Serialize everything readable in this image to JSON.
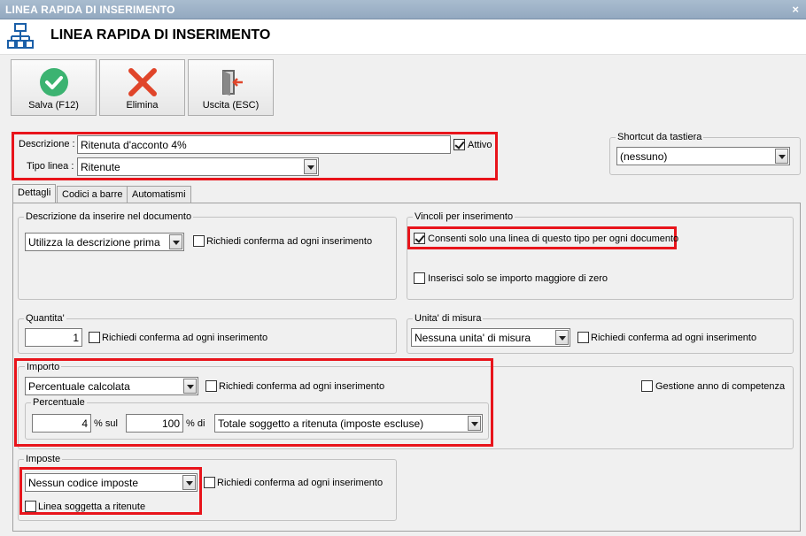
{
  "window": {
    "title": "LINEA RAPIDA DI INSERIMENTO",
    "close_glyph": "×"
  },
  "header": {
    "title": "LINEA RAPIDA DI INSERIMENTO",
    "icon": "network-tree-icon"
  },
  "toolbar": {
    "save_label": "Salva (F12)",
    "delete_label": "Elimina",
    "exit_label": "Uscita (ESC)"
  },
  "main": {
    "descrizione_label": "Descrizione :",
    "descrizione_value": "Ritenuta d'acconto 4%",
    "attivo_label": "Attivo",
    "attivo_checked": true,
    "tipo_linea_label": "Tipo linea :",
    "tipo_linea_value": "Ritenute"
  },
  "shortcut": {
    "title": "Shortcut da tastiera",
    "value": "(nessuno)"
  },
  "tabs": [
    {
      "label": "Dettagli",
      "active": true
    },
    {
      "label": "Codici a barre",
      "active": false
    },
    {
      "label": "Automatismi",
      "active": false
    }
  ],
  "descrizione_doc": {
    "title": "Descrizione da inserire nel documento",
    "combo_value": "Utilizza la descrizione prima",
    "confirm_label": "Richiedi conferma ad ogni inserimento",
    "confirm_checked": false
  },
  "vincoli": {
    "title": "Vincoli per inserimento",
    "one_line_label": "Consenti solo una linea di questo tipo per ogni documento",
    "one_line_checked": true,
    "positive_label": "Inserisci solo se importo maggiore di zero",
    "positive_checked": false
  },
  "quantita": {
    "title": "Quantita'",
    "value": "1",
    "confirm_label": "Richiedi conferma ad ogni inserimento",
    "confirm_checked": false
  },
  "unita": {
    "title": "Unita' di misura",
    "combo_value": "Nessuna unita' di misura",
    "confirm_label": "Richiedi conferma ad ogni inserimento",
    "confirm_checked": false
  },
  "importo": {
    "title": "Importo",
    "combo_value": "Percentuale calcolata",
    "confirm_label": "Richiedi conferma ad ogni inserimento",
    "confirm_checked": false,
    "anno_label": "Gestione anno di competenza",
    "anno_checked": false,
    "percentuale": {
      "title": "Percentuale",
      "value1": "4",
      "sul_label": "% sul",
      "value2": "100",
      "di_label": "% di",
      "combo_value": "Totale soggetto a ritenuta (imposte escluse)"
    }
  },
  "imposte": {
    "title": "Imposte",
    "combo_value": "Nessun codice imposte",
    "confirm_label": "Richiedi conferma ad ogni inserimento",
    "confirm_checked": false,
    "ritenute_label": "Linea soggetta a ritenute",
    "ritenute_checked": false
  },
  "colors": {
    "highlight": "#e8141b",
    "save": "#3cb371",
    "delete": "#e0452a"
  }
}
